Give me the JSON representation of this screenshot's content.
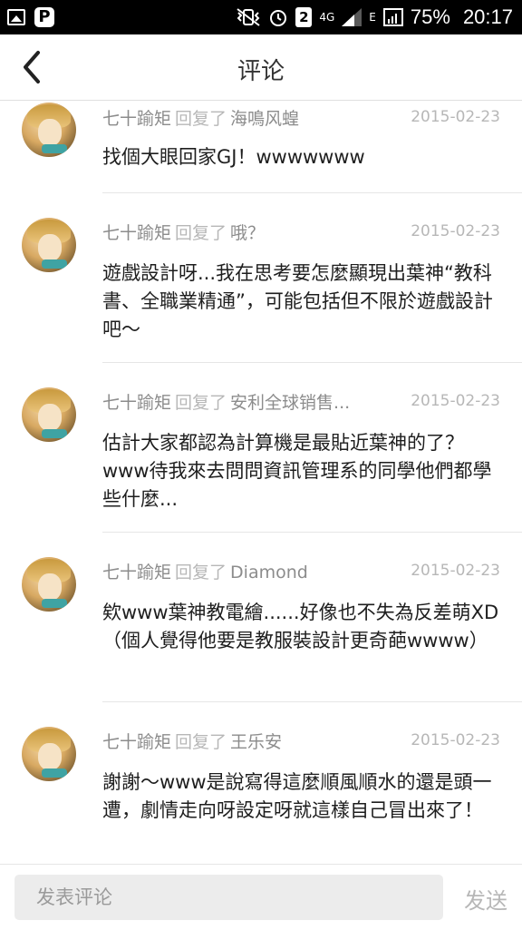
{
  "status_bar": {
    "box_badge": "2",
    "network": "4G",
    "network2": "E",
    "battery": "75%",
    "time": "20:17"
  },
  "header": {
    "title": "评论",
    "back_icon": "chevron-left-icon"
  },
  "reply_word": "回复了",
  "comments": [
    {
      "author": "七十踰矩",
      "target": "海鳴风蝗",
      "date": "2015-02-23",
      "text": "找個大眼回家GJ！wwwwwww"
    },
    {
      "author": "七十踰矩",
      "target": "哦？",
      "date": "2015-02-23",
      "text": "遊戲設計呀...我在思考要怎麼顯現出葉神“教科書、全職業精通”，可能包括但不限於遊戲設計吧～"
    },
    {
      "author": "七十踰矩",
      "target": "安利全球销售...",
      "date": "2015-02-23",
      "text": "估計大家都認為計算機是最貼近葉神的了？www待我來去問問資訊管理系的同學他們都學些什麼..."
    },
    {
      "author": "七十踰矩",
      "target": "Diamond",
      "date": "2015-02-23",
      "text": "欸www葉神教電繪......好像也不失為反差萌XD（個人覺得他要是教服裝設計更奇葩wwww）"
    },
    {
      "author": "七十踰矩",
      "target": "王乐安",
      "date": "2015-02-23",
      "text": "謝謝～www是說寫得這麼順風順水的還是頭一遭，劇情走向呀設定呀就這樣自己冒出來了！"
    }
  ],
  "input": {
    "placeholder": "发表评论",
    "send_label": "发送"
  },
  "colors": {
    "status_bar_bg": "#000000",
    "meta_text": "#8c8c8c",
    "meta_light": "#b7b7b7",
    "body_text": "#1e1e1e",
    "input_bg": "#ececec"
  }
}
